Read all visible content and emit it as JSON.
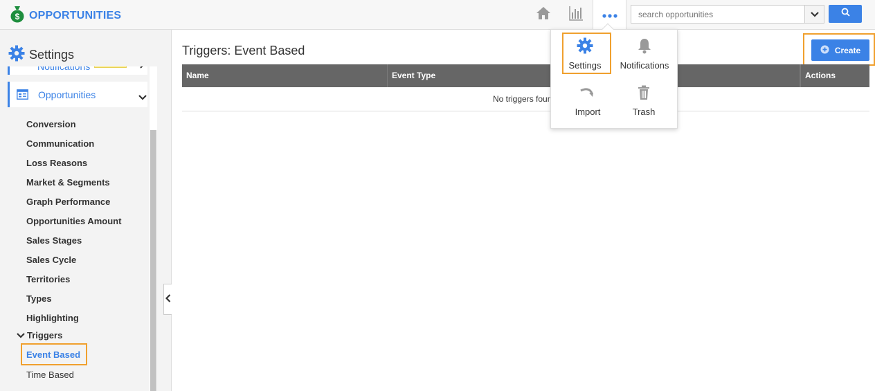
{
  "app": {
    "title": "OPPORTUNITIES"
  },
  "search": {
    "placeholder": "search opportunities"
  },
  "sidebar": {
    "title": "Settings",
    "partial_item": "Notifications",
    "section_label": "Opportunities",
    "items": [
      "Conversion",
      "Communication",
      "Loss Reasons",
      "Market & Segments",
      "Graph Performance",
      "Opportunities Amount",
      "Sales Stages",
      "Sales Cycle",
      "Territories",
      "Types",
      "Highlighting"
    ],
    "triggers": {
      "label": "Triggers",
      "children": [
        "Event Based",
        "Time Based"
      ]
    }
  },
  "main": {
    "title": "Triggers: Event Based",
    "create_label": "Create",
    "columns": [
      "Name",
      "Event Type",
      "Actions"
    ],
    "empty_text": "No triggers foun"
  },
  "dropdown": {
    "items": [
      {
        "label": "Settings",
        "icon": "gear-icon"
      },
      {
        "label": "Notifications",
        "icon": "bell-icon"
      },
      {
        "label": "Import",
        "icon": "import-arrow-icon"
      },
      {
        "label": "Trash",
        "icon": "trash-icon"
      }
    ]
  },
  "colors": {
    "accent": "#3b82e6",
    "highlight": "#f0a02e",
    "table_header": "#666666",
    "brand_green": "#1e8e3e"
  }
}
